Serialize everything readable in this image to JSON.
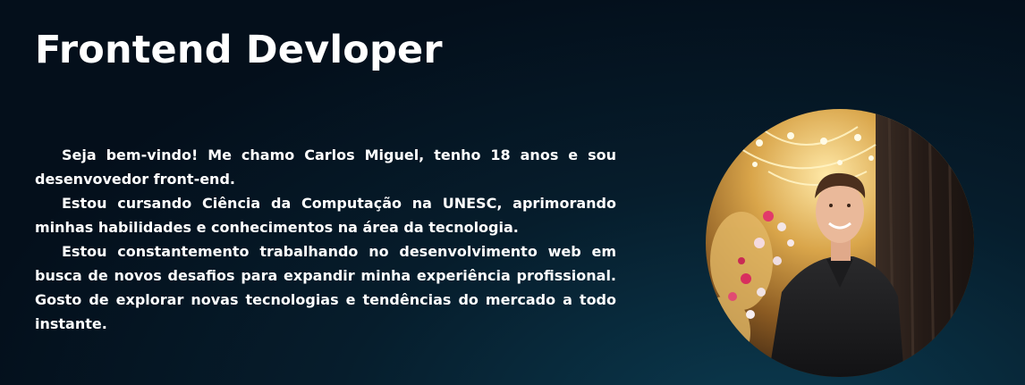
{
  "header": {
    "title": "Frontend Devloper"
  },
  "about": {
    "paragraphs": [
      "Seja bem-vindo! Me chamo Carlos Miguel, tenho 18 anos e sou desenvovedor front-end.",
      "Estou cursando Ciência da Computação na UNESC, aprimorando minhas habilidades e conhecimentos na área da tecnologia.",
      "Estou constantemento trabalhando no desenvolvimento web em busca de novos desafios para expandir minha experiência profissional. Gosto de explorar novas tecnologias e tendências do mercado a todo instante."
    ]
  },
  "photo": {
    "subject": "profile-photo"
  },
  "colors": {
    "background": "#05141f",
    "text": "#ffffff"
  }
}
